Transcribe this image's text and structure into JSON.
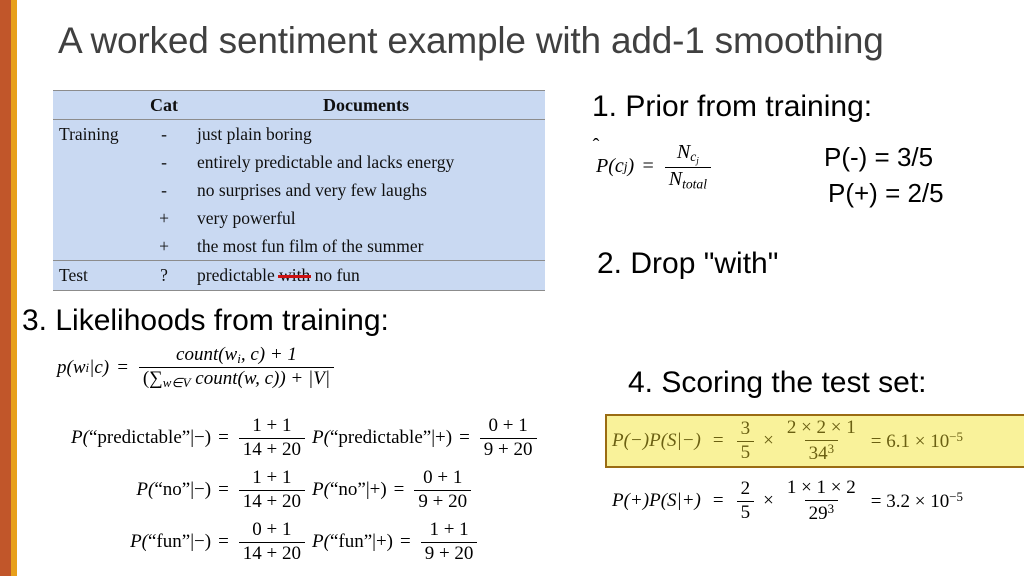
{
  "slide": {
    "title": "A worked sentiment example with add-1 smoothing",
    "accent_rust": "#c1562a",
    "accent_amber": "#e8a01b",
    "title_color": "#404040",
    "table_bg": "#c9d9f2",
    "highlight_bg": "#f9f29a",
    "highlight_border": "#9a6c13",
    "strike_color": "#cc1111"
  },
  "table": {
    "headers": [
      "",
      "Cat",
      "Documents"
    ],
    "rows": [
      {
        "set": "Training",
        "cat": "-",
        "doc": "just plain boring"
      },
      {
        "set": "",
        "cat": "-",
        "doc": "entirely predictable and lacks energy"
      },
      {
        "set": "",
        "cat": "-",
        "doc": "no surprises and very few laughs"
      },
      {
        "set": "",
        "cat": "+",
        "doc": "very powerful"
      },
      {
        "set": "",
        "cat": "+",
        "doc": "the most fun film of the summer"
      }
    ],
    "test_row": {
      "set": "Test",
      "cat": "?",
      "doc_before": "predictable ",
      "doc_struck": "with",
      "doc_after": " no fun"
    }
  },
  "steps": {
    "prior": "1. Prior from training:",
    "drop": "2. Drop \"with\"",
    "likelihoods": "3. Likelihoods from training:",
    "scoring": "4. Scoring the test set:"
  },
  "prior": {
    "formula": {
      "lhs_p": "P",
      "lhs_open": "(c",
      "lhs_sub": "j",
      "lhs_close": ")",
      "eq": "=",
      "num_n": "N",
      "num_sub": "c",
      "num_sub_sub": "j",
      "den_n": "N",
      "den_sub": "total"
    },
    "values": [
      "P(-) = 3/5",
      "P(+) = 2/5"
    ]
  },
  "likelihood_formula": {
    "lhs": "p(w",
    "lhs_sub": "i",
    "lhs_rest": "|c)",
    "eq": "=",
    "numerator": "count(w",
    "numerator_sub": "i",
    "numerator_rest": ", c) + 1",
    "denominator_open": "(∑",
    "denominator_sub": "w∈V",
    "denominator_rest": " count(w, c)) + |V|"
  },
  "likelihoods_negative": [
    {
      "lhs_p": "P",
      "word": "“predictable”",
      "cls": "|−)",
      "num": "1 + 1",
      "den": "14 + 20"
    },
    {
      "lhs_p": "P",
      "word": "“no”",
      "cls": "|−)",
      "num": "1 + 1",
      "den": "14 + 20"
    },
    {
      "lhs_p": "P",
      "word": "“fun”",
      "cls": "|−)",
      "num": "0 + 1",
      "den": "14 + 20"
    }
  ],
  "likelihoods_positive": [
    {
      "lhs_p": "P",
      "word": "“predictable”",
      "cls": "|+)",
      "num": "0 + 1",
      "den": "9 + 20"
    },
    {
      "lhs_p": "P",
      "word": "“no”",
      "cls": "|+)",
      "num": "0 + 1",
      "den": "9 + 20"
    },
    {
      "lhs_p": "P",
      "word": "“fun”",
      "cls": "|+)",
      "num": "1 + 1",
      "den": "9 + 20"
    }
  ],
  "scoring": {
    "negative": {
      "lhs": "P(−)P(S|−)",
      "eq": "=",
      "prior_num": "3",
      "prior_den": "5",
      "times": "×",
      "like_num": "2 × 2 × 1",
      "like_den": "34",
      "like_den_exp": "3",
      "result_eq": "=",
      "result_mant": "6.1 × 10",
      "result_exp": "−5"
    },
    "positive": {
      "lhs": "P(+)P(S|+)",
      "eq": "=",
      "prior_num": "2",
      "prior_den": "5",
      "times": "×",
      "like_num": "1 × 1 × 2",
      "like_den": "29",
      "like_den_exp": "3",
      "result_eq": "=",
      "result_mant": "3.2 × 10",
      "result_exp": "−5"
    }
  }
}
